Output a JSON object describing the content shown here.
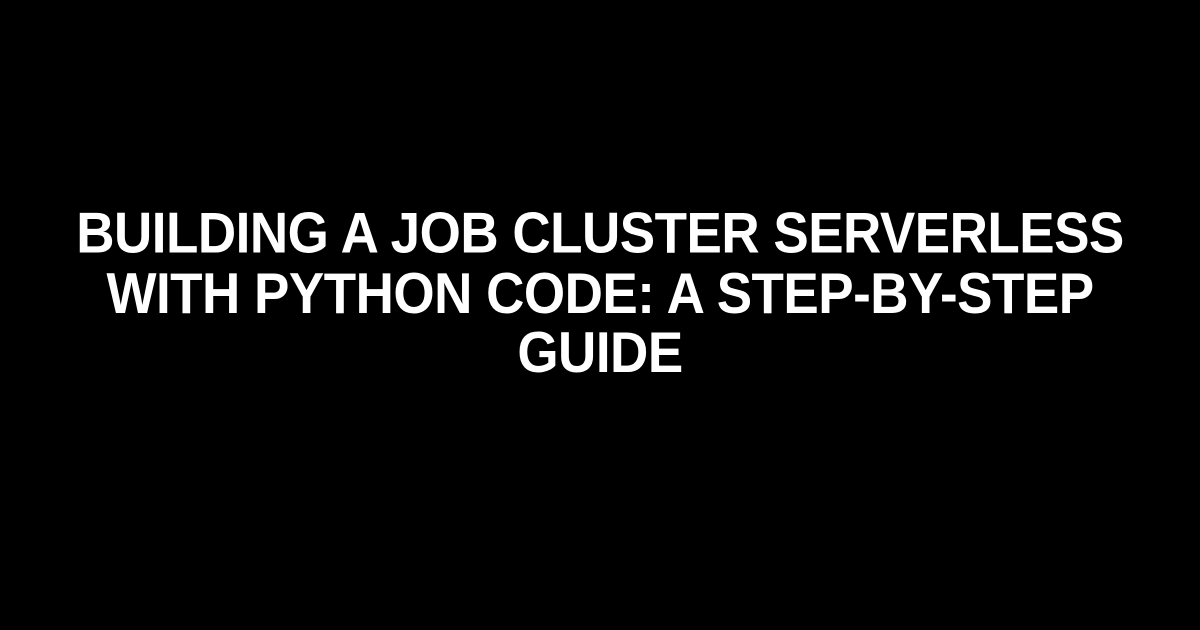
{
  "heading": {
    "text": "Building a Job Cluster Serverless with Python Code: A Step-by-Step Guide"
  }
}
